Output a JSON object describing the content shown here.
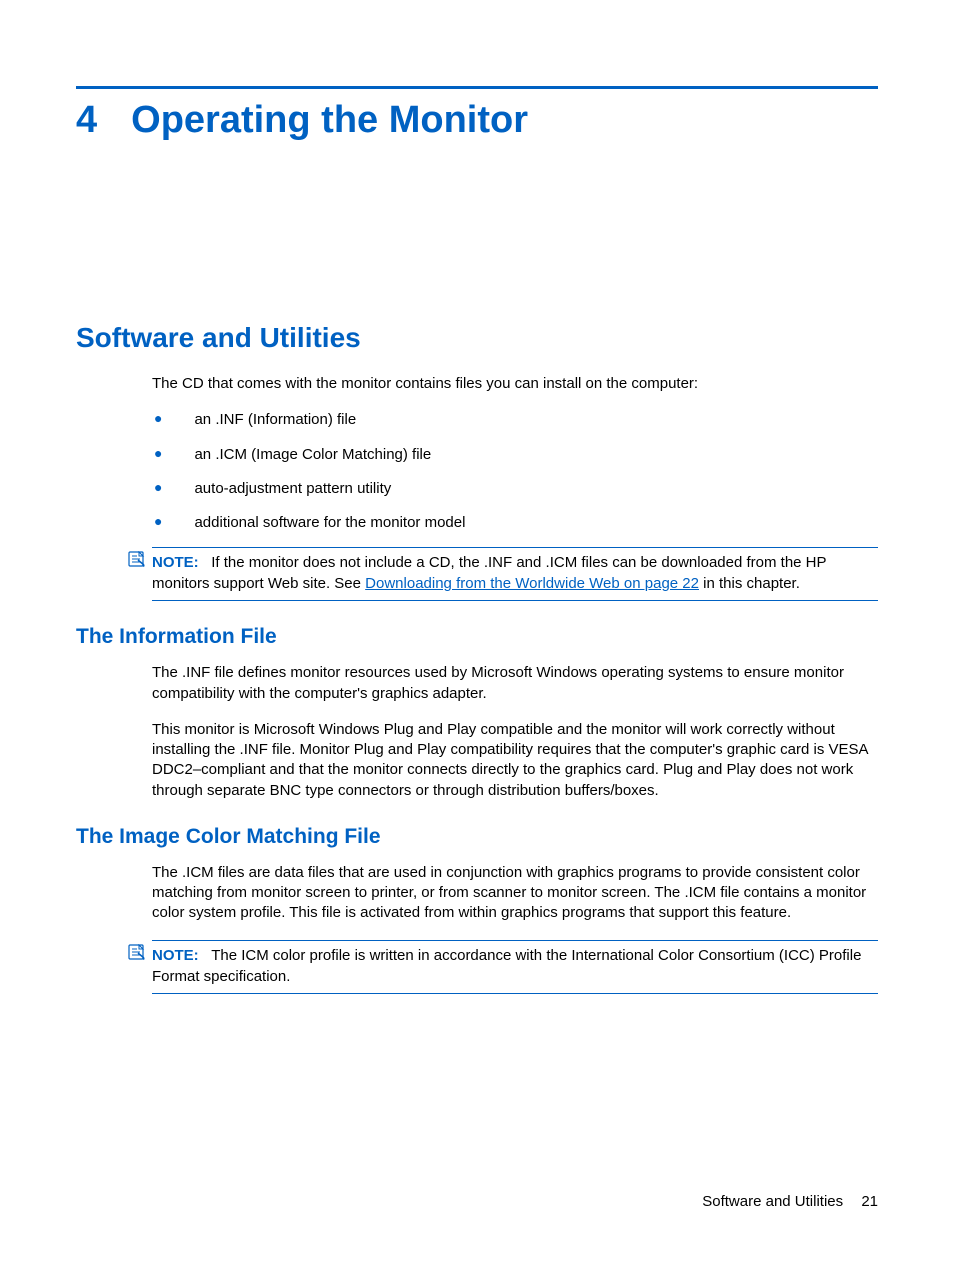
{
  "chapter": {
    "number": "4",
    "title": "Operating the Monitor"
  },
  "section1": {
    "heading": "Software and Utilities",
    "intro": "The CD that comes with the monitor contains files you can install on the computer:",
    "bullets": [
      "an .INF (Information) file",
      "an .ICM (Image Color Matching) file",
      "auto-adjustment pattern utility",
      "additional software for the monitor model"
    ],
    "note": {
      "label": "NOTE:",
      "text_before": "If the monitor does not include a CD, the .INF and .ICM files can be downloaded from the HP monitors support Web site. See ",
      "link": "Downloading from the Worldwide Web on page 22",
      "text_after": " in this chapter."
    }
  },
  "section2": {
    "heading": "The Information File",
    "para1": "The .INF file defines monitor resources used by Microsoft Windows operating systems to ensure monitor compatibility with the computer's graphics adapter.",
    "para2": "This monitor is Microsoft Windows Plug and Play compatible and the monitor will work correctly without installing the .INF file. Monitor Plug and Play compatibility requires that the computer's graphic card is VESA DDC2–compliant and that the monitor connects directly to the graphics card. Plug and Play does not work through separate BNC type connectors or through distribution buffers/boxes."
  },
  "section3": {
    "heading": "The Image Color Matching File",
    "para1": "The .ICM files are data files that are used in conjunction with graphics programs to provide consistent color matching from monitor screen to printer, or from scanner to monitor screen. The .ICM file contains a monitor color system profile. This file is activated from within graphics programs that support this feature.",
    "note": {
      "label": "NOTE:",
      "text": "The ICM color profile is written in accordance with the International Color Consortium (ICC) Profile Format specification."
    }
  },
  "footer": {
    "section": "Software and Utilities",
    "page": "21"
  }
}
